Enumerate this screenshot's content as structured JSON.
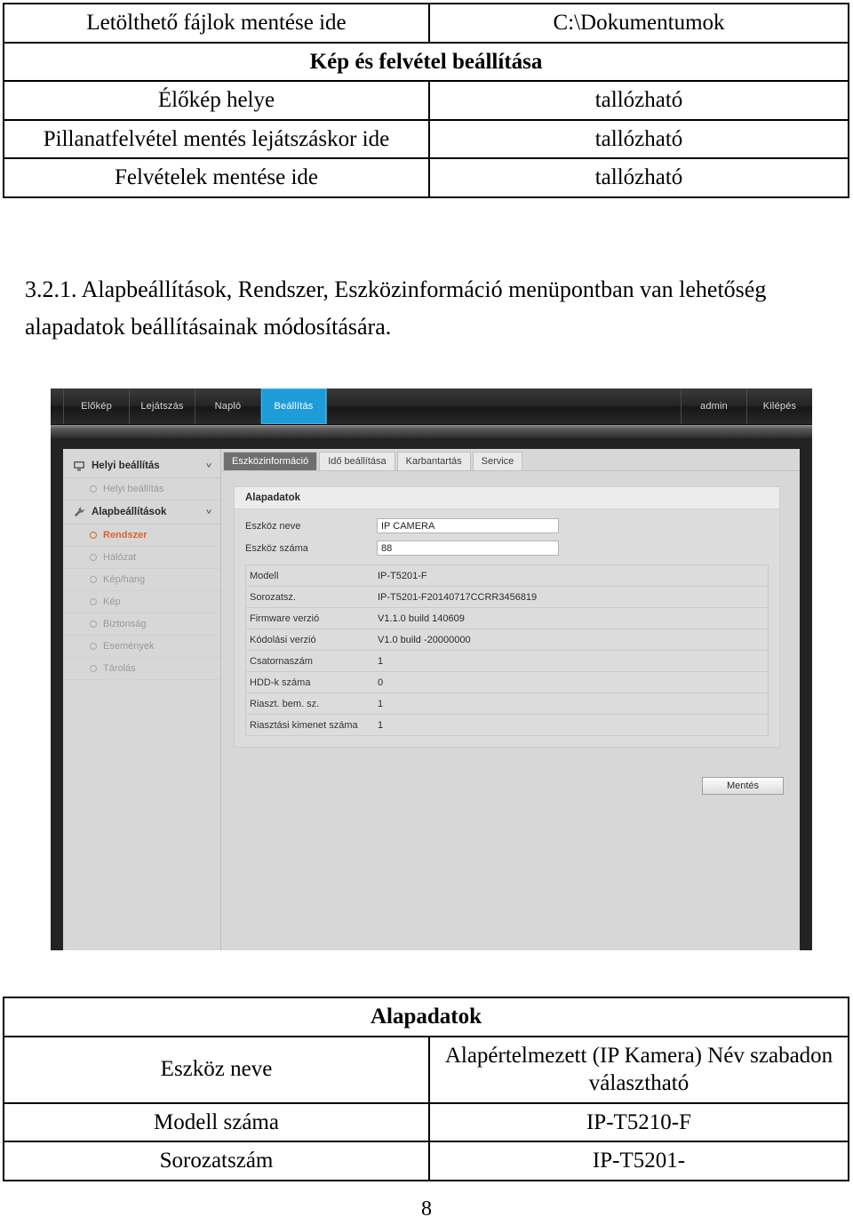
{
  "table_top": {
    "rows": [
      {
        "cells": [
          "Letölthető fájlok mentése ide",
          "C:\\Dokumentumok"
        ]
      },
      {
        "span_label": "Kép és felvétel beállítása"
      },
      {
        "cells": [
          "Élőkép helye",
          "tallózható"
        ]
      },
      {
        "cells": [
          "Pillanatfelvétel mentés lejátszáskor ide",
          "tallózható"
        ]
      },
      {
        "cells": [
          "Felvételek mentése ide",
          "tallózható"
        ]
      }
    ]
  },
  "paragraph": {
    "text": "3.2.1. Alapbeállítások, Rendszer, Eszközinformáció menüpontban van lehetőség alapadatok beállításainak módosítására."
  },
  "screenshot": {
    "nav": {
      "items": [
        {
          "label": "Előkép",
          "active": false
        },
        {
          "label": "Lejátszás",
          "active": false
        },
        {
          "label": "Napló",
          "active": false
        },
        {
          "label": "Beállítás",
          "active": true
        }
      ],
      "right": [
        {
          "label": "admin"
        },
        {
          "label": "Kilépés"
        }
      ],
      "accent_color": "#1e9cd7"
    },
    "sidebar": {
      "groups": [
        {
          "label": "Helyi beállítás",
          "icon": "monitor-icon",
          "chevron": "˅",
          "items": [
            {
              "label": "Helyi beállítás",
              "selected": false
            }
          ]
        },
        {
          "label": "Alapbeállítások",
          "icon": "wrench-icon",
          "chevron": "˅",
          "items": [
            {
              "label": "Rendszer",
              "selected": true
            },
            {
              "label": "Hálózat",
              "selected": false
            },
            {
              "label": "Kép/hang",
              "selected": false
            },
            {
              "label": "Kép",
              "selected": false
            },
            {
              "label": "Biztonság",
              "selected": false
            },
            {
              "label": "Események",
              "selected": false
            },
            {
              "label": "Tárolás",
              "selected": false
            }
          ]
        }
      ],
      "selected_color": "#e06030"
    },
    "tabs": [
      {
        "label": "Eszközinformáció",
        "active": true
      },
      {
        "label": "Idő beállítása",
        "active": false
      },
      {
        "label": "Karbantartás",
        "active": false
      },
      {
        "label": "Service",
        "active": false
      }
    ],
    "panel": {
      "title": "Alapadatok",
      "fields": [
        {
          "label": "Eszköz neve",
          "value": "IP CAMERA"
        },
        {
          "label": "Eszköz száma",
          "value": "88"
        }
      ],
      "info_rows": [
        {
          "key": "Modell",
          "value": "IP-T5201-F"
        },
        {
          "key": "Sorozatsz.",
          "value": "IP-T5201-F20140717CCRR3456819"
        },
        {
          "key": "Firmware verzió",
          "value": "V1.1.0 build 140609"
        },
        {
          "key": "Kódolási verzió",
          "value": "V1.0 build -20000000"
        },
        {
          "key": "Csatornaszám",
          "value": "1"
        },
        {
          "key": "HDD-k száma",
          "value": "0"
        },
        {
          "key": "Riaszt. bem. sz.",
          "value": "1"
        },
        {
          "key": "Riasztási kimenet száma",
          "value": "1"
        }
      ]
    },
    "save_button": "Mentés"
  },
  "table_bottom": {
    "rows": [
      {
        "span_label": "Alapadatok"
      },
      {
        "cells": [
          "Eszköz neve",
          "Alapértelmezett (IP Kamera) Név szabadon választható"
        ]
      },
      {
        "cells": [
          "Modell száma",
          "IP-T5210-F"
        ]
      },
      {
        "cells": [
          "Sorozatszám",
          "IP-T5201-"
        ]
      }
    ]
  },
  "page_number": "8"
}
